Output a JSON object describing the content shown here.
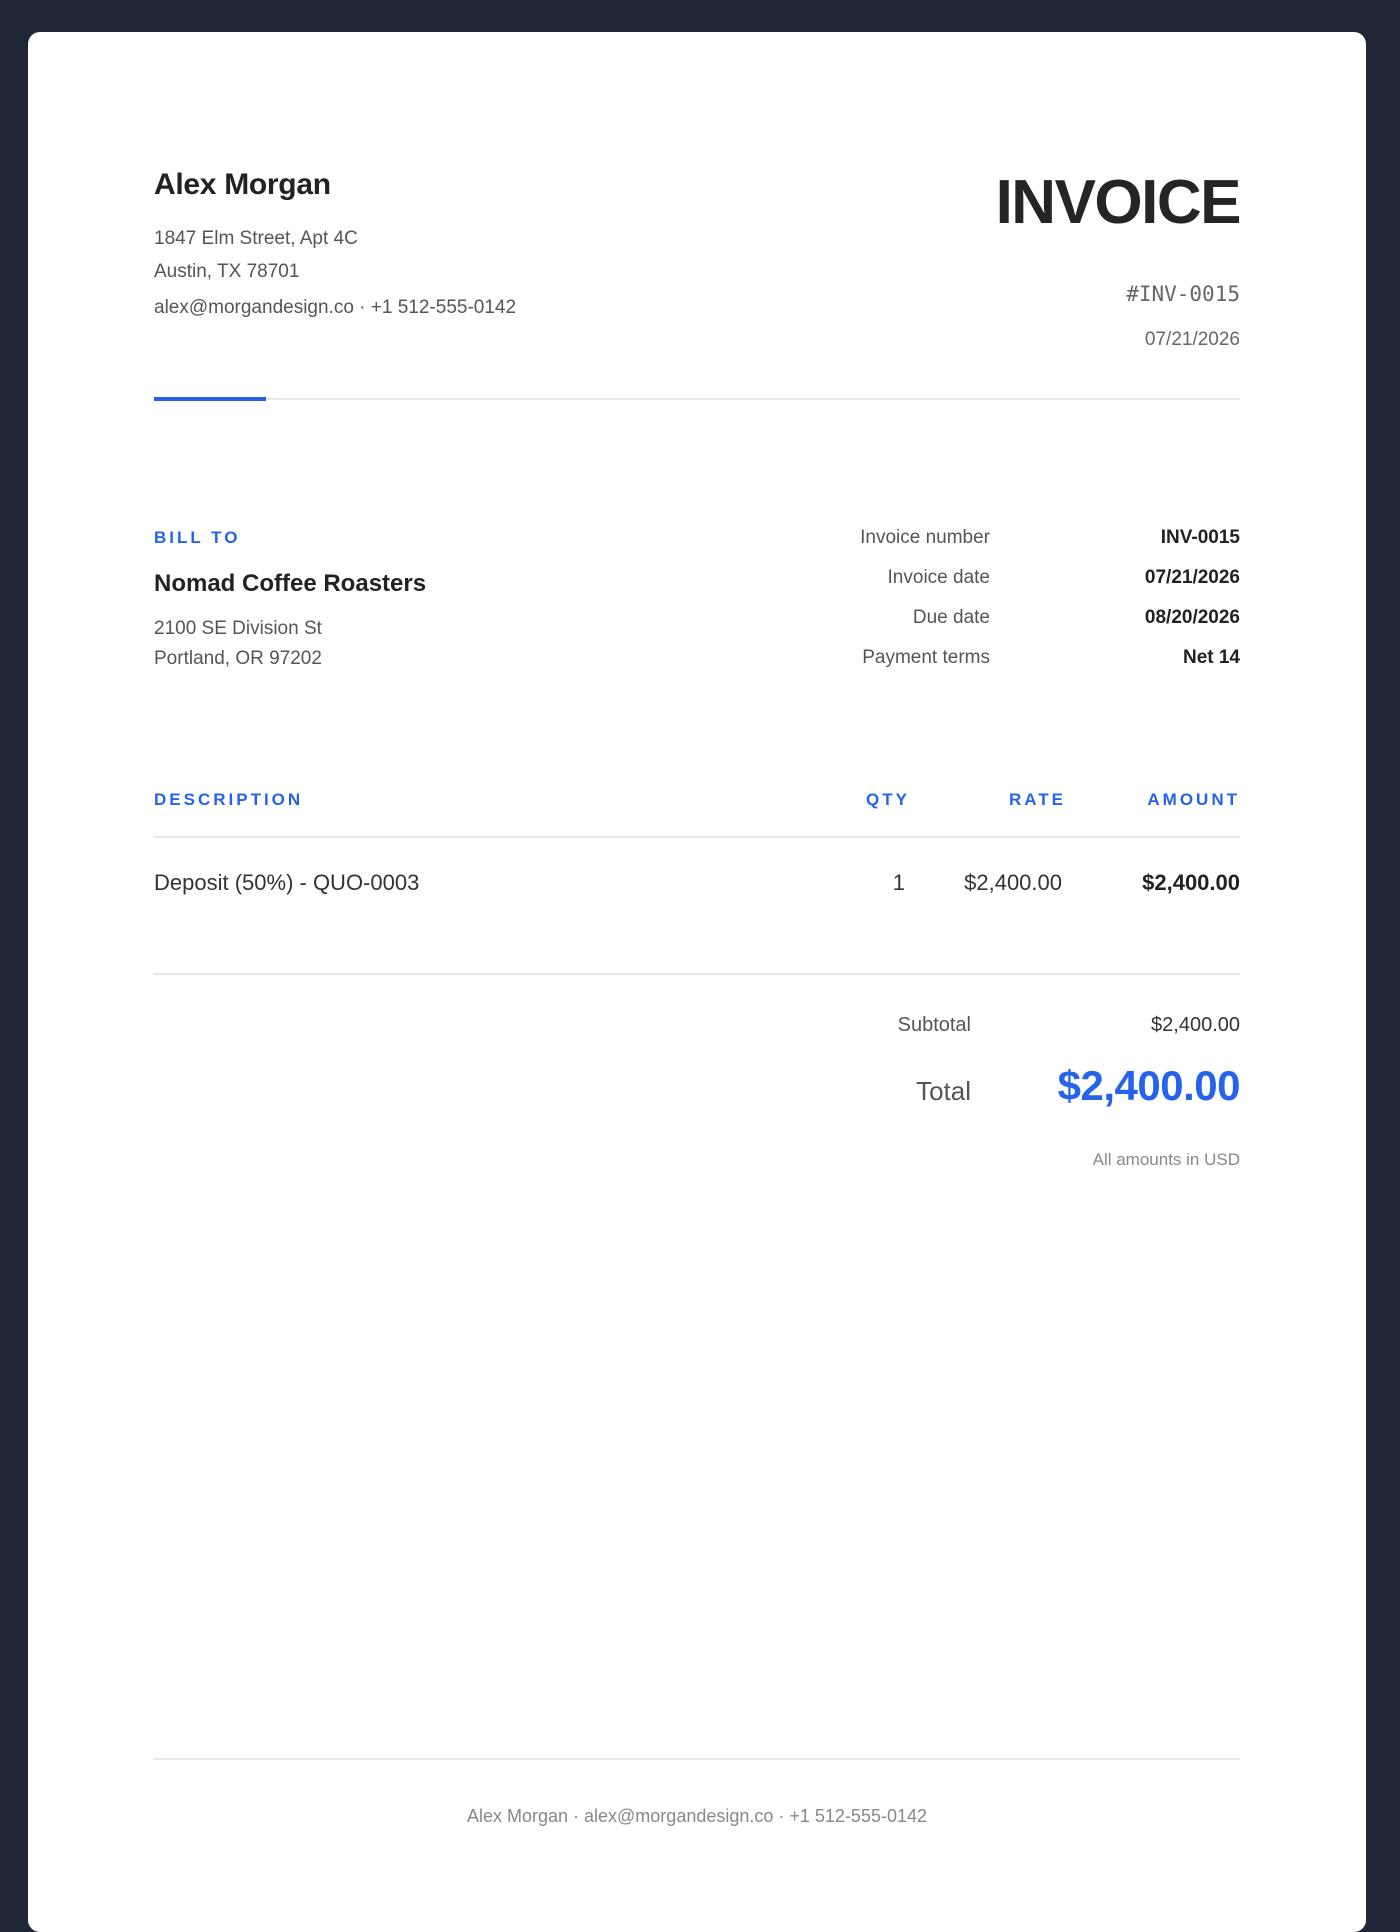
{
  "sender": {
    "name": "Alex Morgan",
    "address_line1": "1847 Elm Street, Apt 4C",
    "address_line2": "Austin, TX 78701",
    "contact": "alex@morgandesign.co · +1 512-555-0142"
  },
  "header": {
    "title": "INVOICE",
    "number": "#INV-0015",
    "date": "07/21/2026"
  },
  "bill_to": {
    "label": "BILL TO",
    "name": "Nomad Coffee Roasters",
    "address_line1": "2100 SE Division St",
    "address_line2": "Portland, OR 97202"
  },
  "meta": [
    {
      "label": "Invoice number",
      "value": "INV-0015"
    },
    {
      "label": "Invoice date",
      "value": "07/21/2026"
    },
    {
      "label": "Due date",
      "value": "08/20/2026"
    },
    {
      "label": "Payment terms",
      "value": "Net 14"
    }
  ],
  "table": {
    "headers": {
      "description": "DESCRIPTION",
      "qty": "QTY",
      "rate": "RATE",
      "amount": "AMOUNT"
    },
    "rows": [
      {
        "description": "Deposit (50%) - QUO-0003",
        "qty": "1",
        "rate": "$2,400.00",
        "amount": "$2,400.00"
      }
    ]
  },
  "totals": {
    "subtotal_label": "Subtotal",
    "subtotal_value": "$2,400.00",
    "total_label": "Total",
    "total_value": "$2,400.00",
    "currency_note": "All amounts in USD"
  },
  "footer": {
    "text": "Alex Morgan · alex@morgandesign.co · +1 512-555-0142"
  },
  "colors": {
    "accent": "#2563eb",
    "background": "#1f2737",
    "page": "#ffffff"
  }
}
